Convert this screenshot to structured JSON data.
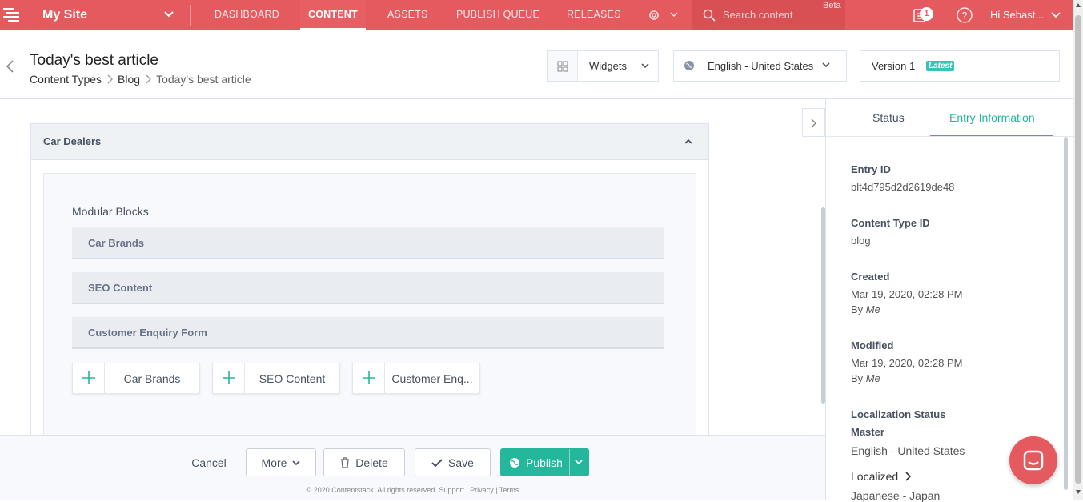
{
  "topbar": {
    "site_name": "My Site",
    "nav": [
      "DASHBOARD",
      "CONTENT",
      "ASSETS",
      "PUBLISH QUEUE",
      "RELEASES"
    ],
    "active_nav": "CONTENT",
    "search_placeholder": "Search content",
    "beta_label": "Beta",
    "tasks_count": "1",
    "user_label": "Hi Sebast...",
    "colors": {
      "brand": "#e45a5e",
      "accent": "#25b79b"
    }
  },
  "header": {
    "title": "Today's best article",
    "breadcrumbs": [
      "Content Types",
      "Blog",
      "Today's best article"
    ],
    "widgets_label": "Widgets",
    "locale_label": "English - United States",
    "version_label": "Version 1",
    "version_badge": "Latest"
  },
  "card": {
    "title": "Car Dealers",
    "modular_label": "Modular Blocks",
    "blocks": [
      "Car Brands",
      "SEO Content",
      "Customer Enquiry Form"
    ],
    "add_buttons": [
      "Car Brands",
      "SEO Content",
      "Customer Enq..."
    ]
  },
  "footer": {
    "cancel": "Cancel",
    "more": "More",
    "delete": "Delete",
    "save": "Save",
    "publish": "Publish",
    "copyright": "© 2020 Contentstack. All rights reserved. Support | Privacy | Terms"
  },
  "sidebar": {
    "tabs": [
      "Status",
      "Entry Information"
    ],
    "active_tab": "Entry Information",
    "entry_id_label": "Entry ID",
    "entry_id": "blt4d795d2d2619de48",
    "content_type_label": "Content Type ID",
    "content_type": "blog",
    "created_label": "Created",
    "created": "Mar 19, 2020, 02:28 PM",
    "created_by_prefix": "By",
    "created_by": "Me",
    "modified_label": "Modified",
    "modified": "Mar 19, 2020, 02:28 PM",
    "modified_by_prefix": "By",
    "modified_by": "Me",
    "localization_label": "Localization Status",
    "master_label": "Master",
    "master_locale": "English - United States",
    "localized_label": "Localized",
    "localized_locale": "Japanese - Japan"
  }
}
